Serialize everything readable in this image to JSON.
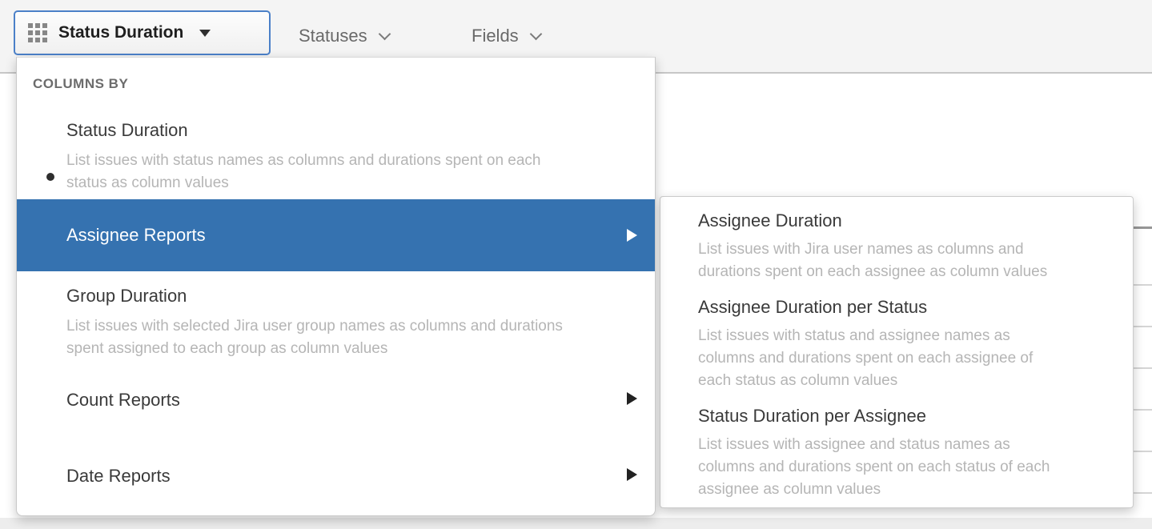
{
  "colors": {
    "highlight-blue": "#3572b0",
    "button-border-blue": "#4b80c8",
    "topbar-bg": "#f4f4f4",
    "title-text": "#3a3a3a",
    "muted-text": "#b5b5b5"
  },
  "toolbar": {
    "view_button": {
      "label": "Status Duration",
      "icon": "grid-icon",
      "state": "open"
    },
    "items": [
      {
        "label": "Statuses"
      },
      {
        "label": "Fields"
      }
    ]
  },
  "menu": {
    "section_label": "COLUMNS BY",
    "items": [
      {
        "title": "Status Duration",
        "selected": true,
        "description": "List issues with status names as columns and durations spent on each status as column values"
      },
      {
        "title": "Assignee Reports",
        "highlighted": true,
        "has_submenu": true
      },
      {
        "title": "Group Duration",
        "description": "List issues with selected Jira user group names as columns and durations spent assigned to each group as column values"
      },
      {
        "title": "Count Reports",
        "has_submenu": true
      },
      {
        "title": "Date Reports",
        "has_submenu": true
      }
    ]
  },
  "submenu": {
    "items": [
      {
        "title": "Assignee Duration",
        "description": "List issues with Jira user names as columns and durations spent on each assignee as column values"
      },
      {
        "title": "Assignee Duration per Status",
        "description": "List issues with status and assignee names as columns and durations spent on each assignee of each status as column values"
      },
      {
        "title": "Status Duration per Assignee",
        "description": "List issues with assignee and status names as columns and durations spent on each status of each assignee as column values"
      }
    ]
  }
}
